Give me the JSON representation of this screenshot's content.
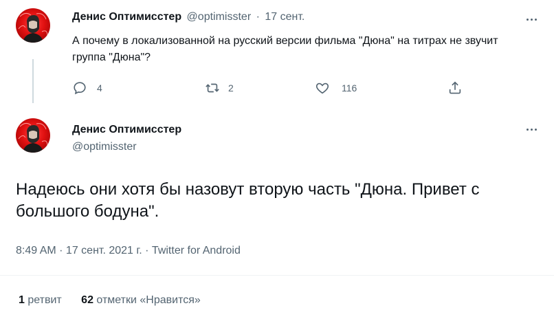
{
  "parent_tweet": {
    "display_name": "Денис Оптимисстер",
    "handle": "@optimisster",
    "separator": "·",
    "date": "17 сент.",
    "text": "А почему в локализованной на русский версии фильма \"Дюна\" на титрах не звучит группа \"Дюна\"?",
    "reply_count": "4",
    "retweet_count": "2",
    "like_count": "116"
  },
  "main_tweet": {
    "display_name": "Денис Оптимисстер",
    "handle": "@optimisster",
    "text": "Надеюсь они хотя бы назовут вторую часть \"Дюна. Привет с большого бодуна\".",
    "meta": "8:49 AM · 17 сент. 2021 г. · Twitter for Android",
    "retweets_number": "1",
    "retweets_label": "ретвит",
    "likes_number": "62",
    "likes_label": "отметки «Нравится»"
  },
  "colors": {
    "text": "#0f1419",
    "muted": "#536471",
    "divider": "#eff3f4",
    "avatar_red": "#e01010"
  },
  "icons": [
    "reply-icon",
    "retweet-icon",
    "like-icon",
    "share-icon",
    "more-icon"
  ]
}
